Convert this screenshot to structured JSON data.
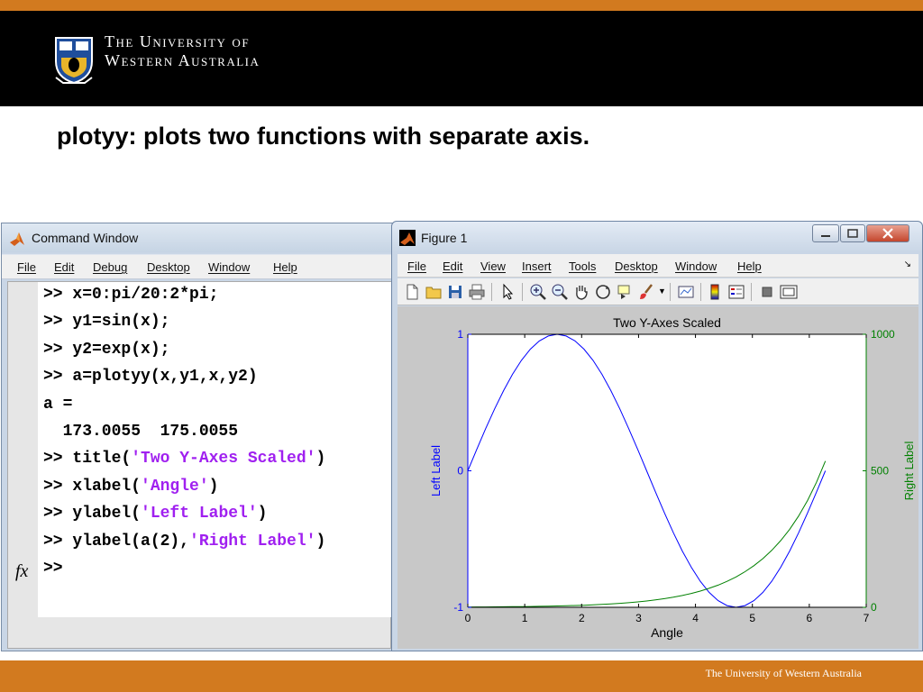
{
  "header": {
    "university_line1": "The University of",
    "university_line2": "Western Australia"
  },
  "slide": {
    "title": "plotyy: plots two functions with separate axis."
  },
  "footer": {
    "text": "The University of Western Australia"
  },
  "command_window": {
    "title": "Command Window",
    "menu": [
      "File",
      "Edit",
      "Debug",
      "Desktop",
      "Window",
      "Help"
    ],
    "lines": [
      {
        "prompt": ">> ",
        "code": "x=0:pi/20:2*pi;",
        "str": "",
        "tail": ""
      },
      {
        "prompt": ">> ",
        "code": "y1=sin(x);",
        "str": "",
        "tail": ""
      },
      {
        "prompt": ">> ",
        "code": "y2=exp(x);",
        "str": "",
        "tail": ""
      },
      {
        "prompt": ">> ",
        "code": "a=plotyy(x,y1,x,y2)",
        "str": "",
        "tail": ""
      },
      {
        "prompt": "",
        "code": "a =",
        "str": "",
        "tail": ""
      },
      {
        "prompt": "",
        "code": "  173.0055  175.0055",
        "str": "",
        "tail": ""
      },
      {
        "prompt": ">> ",
        "code": "title(",
        "str": "'Two Y-Axes Scaled'",
        "tail": ")"
      },
      {
        "prompt": ">> ",
        "code": "xlabel(",
        "str": "'Angle'",
        "tail": ")"
      },
      {
        "prompt": ">> ",
        "code": "ylabel(",
        "str": "'Left Label'",
        "tail": ")"
      },
      {
        "prompt": ">> ",
        "code": "ylabel(a(2),",
        "str": "'Right Label'",
        "tail": ")"
      },
      {
        "prompt": ">>",
        "code": "",
        "str": "",
        "tail": ""
      }
    ],
    "fx_label": "fx",
    "string_color": "#a020f0"
  },
  "figure_window": {
    "title": "Figure 1",
    "menu": [
      "File",
      "Edit",
      "View",
      "Insert",
      "Tools",
      "Desktop",
      "Window",
      "Help"
    ],
    "toolbar_icons": [
      "new-file-icon",
      "open-folder-icon",
      "save-icon",
      "print-icon",
      "pointer-icon",
      "zoom-in-icon",
      "zoom-out-icon",
      "pan-hand-icon",
      "rotate-3d-icon",
      "data-cursor-icon",
      "brush-icon",
      "link-plot-icon",
      "colorbar-icon",
      "legend-icon",
      "hide-plot-tools-icon",
      "show-plot-tools-icon"
    ]
  },
  "chart_data": {
    "type": "line",
    "title": "Two Y-Axes Scaled",
    "xlabel": "Angle",
    "ylabel_left": "Left Label",
    "ylabel_right": "Right Label",
    "xlim": [
      0,
      7
    ],
    "ylim_left": [
      -1,
      1
    ],
    "ylim_right": [
      0,
      1000
    ],
    "xticks": [
      "0",
      "1",
      "2",
      "3",
      "4",
      "5",
      "6",
      "7"
    ],
    "yticks_left": [
      "-1",
      "0",
      "1"
    ],
    "yticks_right": [
      "0",
      "500",
      "1000"
    ],
    "grid": false,
    "x_range": [
      0,
      6.2832
    ],
    "x_step": 0.15708,
    "series": [
      {
        "function": "sin(x)",
        "axis": "left",
        "color": "#0000ff"
      },
      {
        "function": "exp(x)",
        "axis": "right",
        "color": "#008000"
      }
    ],
    "left_axis_color": "#0000ff",
    "right_axis_color": "#008000"
  }
}
